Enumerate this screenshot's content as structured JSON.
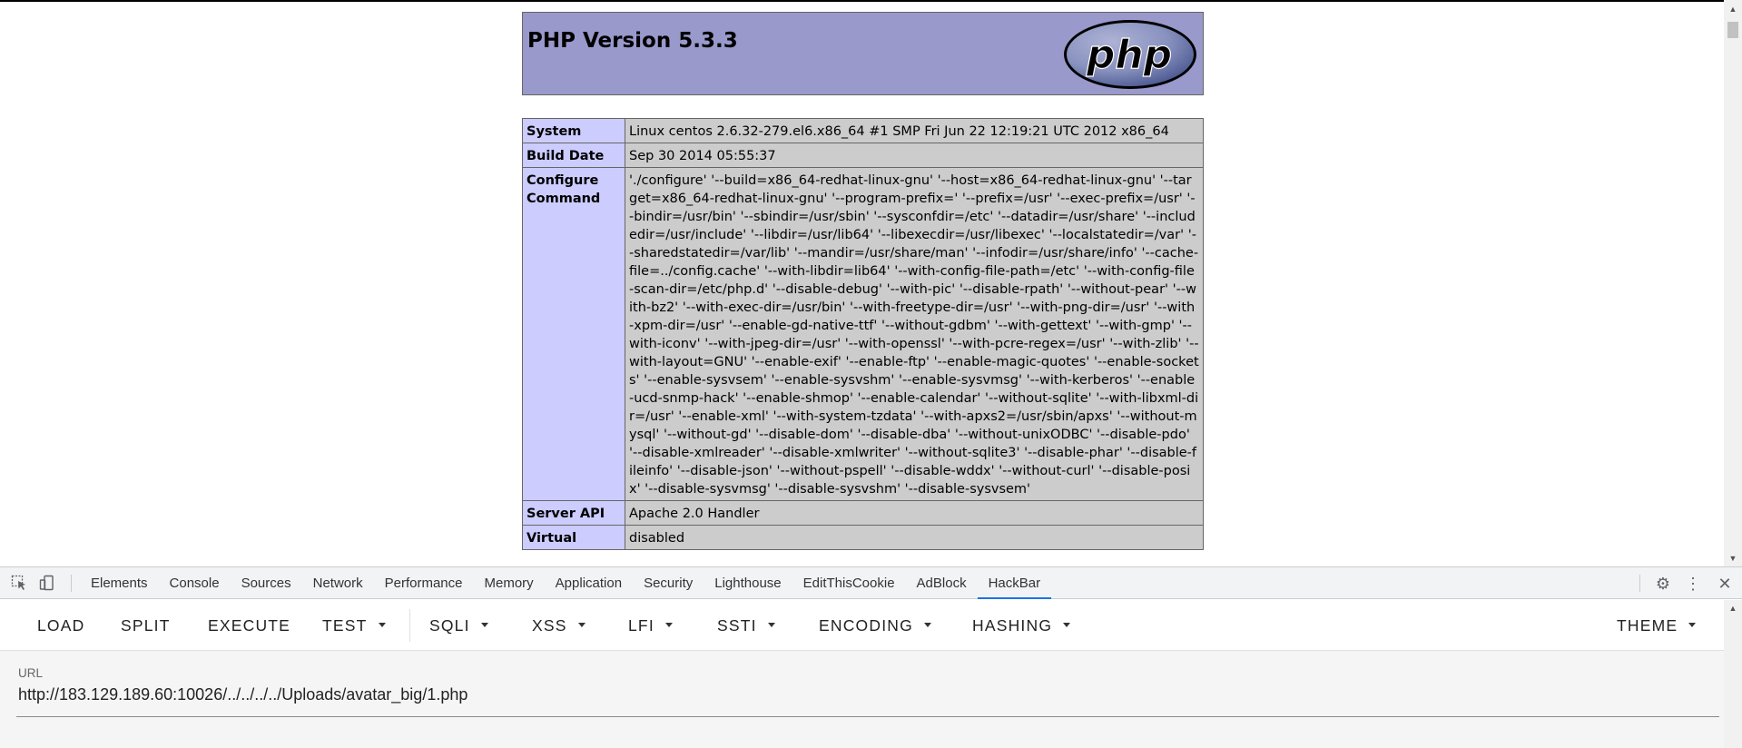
{
  "php": {
    "title": "PHP Version 5.3.3",
    "logo_text": "php",
    "rows": [
      {
        "key": "System",
        "value": "Linux centos 2.6.32-279.el6.x86_64 #1 SMP Fri Jun 22 12:19:21 UTC 2012 x86_64"
      },
      {
        "key": "Build Date",
        "value": "Sep 30 2014 05:55:37"
      },
      {
        "key": "Configure Command",
        "value": "'./configure' '--build=x86_64-redhat-linux-gnu' '--host=x86_64-redhat-linux-gnu' '--target=x86_64-redhat-linux-gnu' '--program-prefix=' '--prefix=/usr' '--exec-prefix=/usr' '--bindir=/usr/bin' '--sbindir=/usr/sbin' '--sysconfdir=/etc' '--datadir=/usr/share' '--includedir=/usr/include' '--libdir=/usr/lib64' '--libexecdir=/usr/libexec' '--localstatedir=/var' '--sharedstatedir=/var/lib' '--mandir=/usr/share/man' '--infodir=/usr/share/info' '--cache-file=../config.cache' '--with-libdir=lib64' '--with-config-file-path=/etc' '--with-config-file-scan-dir=/etc/php.d' '--disable-debug' '--with-pic' '--disable-rpath' '--without-pear' '--with-bz2' '--with-exec-dir=/usr/bin' '--with-freetype-dir=/usr' '--with-png-dir=/usr' '--with-xpm-dir=/usr' '--enable-gd-native-ttf' '--without-gdbm' '--with-gettext' '--with-gmp' '--with-iconv' '--with-jpeg-dir=/usr' '--with-openssl' '--with-pcre-regex=/usr' '--with-zlib' '--with-layout=GNU' '--enable-exif' '--enable-ftp' '--enable-magic-quotes' '--enable-sockets' '--enable-sysvsem' '--enable-sysvshm' '--enable-sysvmsg' '--with-kerberos' '--enable-ucd-snmp-hack' '--enable-shmop' '--enable-calendar' '--without-sqlite' '--with-libxml-dir=/usr' '--enable-xml' '--with-system-tzdata' '--with-apxs2=/usr/sbin/apxs' '--without-mysql' '--without-gd' '--disable-dom' '--disable-dba' '--without-unixODBC' '--disable-pdo' '--disable-xmlreader' '--disable-xmlwriter' '--without-sqlite3' '--disable-phar' '--disable-fileinfo' '--disable-json' '--without-pspell' '--disable-wddx' '--without-curl' '--disable-posix' '--disable-sysvmsg' '--disable-sysvshm' '--disable-sysvsem'"
      },
      {
        "key": "Server API",
        "value": "Apache 2.0 Handler"
      },
      {
        "key": "Virtual",
        "value": "disabled"
      }
    ]
  },
  "devtools": {
    "tabs": [
      "Elements",
      "Console",
      "Sources",
      "Network",
      "Performance",
      "Memory",
      "Application",
      "Security",
      "Lighthouse",
      "EditThisCookie",
      "AdBlock",
      "HackBar"
    ],
    "active_tab": "HackBar",
    "icons": {
      "inspect": "inspect-element-icon",
      "device": "device-toolbar-icon",
      "settings": "gear-icon",
      "more": "more-vertical-icon",
      "close": "close-icon"
    },
    "accent": "#1a73e8"
  },
  "hackbar": {
    "buttons": {
      "load": "LOAD",
      "split": "SPLIT",
      "execute": "EXECUTE",
      "test": "TEST",
      "sqli": "SQLI",
      "xss": "XSS",
      "lfi": "LFI",
      "ssti": "SSTI",
      "encoding": "ENCODING",
      "hashing": "HASHING",
      "theme": "THEME"
    },
    "url_label": "URL",
    "url_value": "http://183.129.189.60:10026/../../../../Uploads/avatar_big/1.php"
  }
}
